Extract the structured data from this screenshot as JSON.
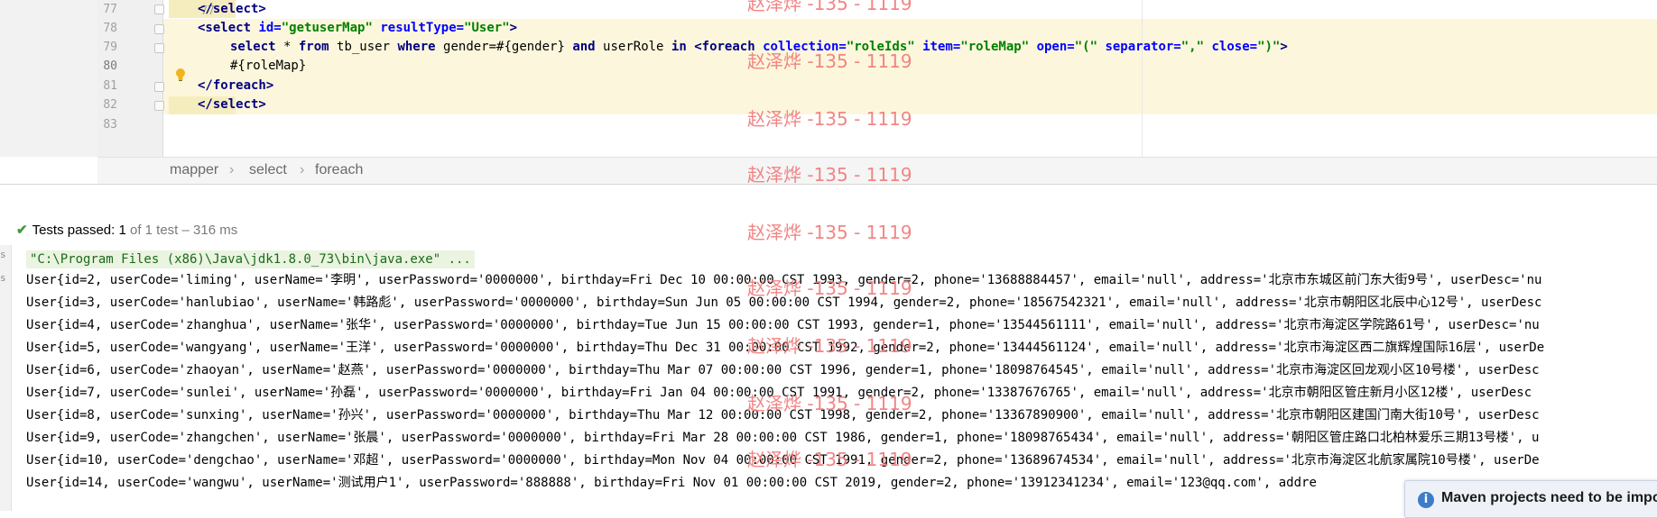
{
  "editor": {
    "line_numbers": [
      "77",
      "78",
      "79",
      "80",
      "81",
      "82",
      "83"
    ],
    "code": {
      "l77_close_select": "</select>",
      "l78_select_open": "<select",
      "l78_attr_id": "id=",
      "l78_val_id": "\"getuserMap\"",
      "l78_attr_type": "resultType=",
      "l78_val_type": "\"User\"",
      "l78_end": ">",
      "l79_sql_select": "select",
      "l79_sql_star": " * ",
      "l79_sql_from": "from",
      "l79_sql_table": " tb_user ",
      "l79_sql_where": "where",
      "l79_sql_gender": " gender=#{gender} ",
      "l79_sql_and": "and",
      "l79_sql_userrole": " userRole ",
      "l79_sql_in": "in",
      "l79_space": " ",
      "l79_foreach_open": "<foreach",
      "l79_attr_collection": "collection=",
      "l79_val_collection": "\"roleIds\"",
      "l79_attr_item": "item=",
      "l79_val_item": "\"roleMap\"",
      "l79_attr_open": "open=",
      "l79_val_open": "\"(\"",
      "l79_attr_separator": "separator=",
      "l79_val_separator": "\",\"",
      "l79_attr_close": "close=",
      "l79_val_close": "\")\"",
      "l79_end": ">",
      "l80_rolemap": "#{roleMap}",
      "l81_close_foreach": "</foreach>",
      "l82_close_select": "</select>"
    }
  },
  "breadcrumbs": [
    "mapper",
    "select",
    "foreach"
  ],
  "breadcrumb_separator": "›",
  "tests": {
    "passed_label": "Tests passed:",
    "passed_count": "1",
    "detail": "of 1 test – 316 ms"
  },
  "console": {
    "command": "\"C:\\Program Files (x86)\\Java\\jdk1.8.0_73\\bin\\java.exe\" ...",
    "lines": [
      "User{id=2, userCode='liming', userName='李明', userPassword='0000000', birthday=Fri Dec 10 00:00:00 CST 1993, gender=2, phone='13688884457', email='null', address='北京市东城区前门东大街9号', userDesc='nu",
      "User{id=3, userCode='hanlubiao', userName='韩路彪', userPassword='0000000', birthday=Sun Jun 05 00:00:00 CST 1994, gender=2, phone='18567542321', email='null', address='北京市朝阳区北辰中心12号', userDesc",
      "User{id=4, userCode='zhanghua', userName='张华', userPassword='0000000', birthday=Tue Jun 15 00:00:00 CST 1993, gender=1, phone='13544561111', email='null', address='北京市海淀区学院路61号', userDesc='nu",
      "User{id=5, userCode='wangyang', userName='王洋', userPassword='0000000', birthday=Thu Dec 31 00:00:00 CST 1992, gender=2, phone='13444561124', email='null', address='北京市海淀区西二旗辉煌国际16层', userDe",
      "User{id=6, userCode='zhaoyan', userName='赵燕', userPassword='0000000', birthday=Thu Mar 07 00:00:00 CST 1996, gender=1, phone='18098764545', email='null', address='北京市海淀区回龙观小区10号楼', userDesc",
      "User{id=7, userCode='sunlei', userName='孙磊', userPassword='0000000', birthday=Fri Jan 04 00:00:00 CST 1991, gender=2, phone='13387676765', email='null', address='北京市朝阳区管庄新月小区12楼', userDesc",
      "User{id=8, userCode='sunxing', userName='孙兴', userPassword='0000000', birthday=Thu Mar 12 00:00:00 CST 1998, gender=2, phone='13367890900', email='null', address='北京市朝阳区建国门南大街10号', userDesc",
      "User{id=9, userCode='zhangchen', userName='张晨', userPassword='0000000', birthday=Fri Mar 28 00:00:00 CST 1986, gender=1, phone='18098765434', email='null', address='朝阳区管庄路口北柏林爱乐三期13号楼', u",
      "User{id=10, userCode='dengchao', userName='邓超', userPassword='0000000', birthday=Mon Nov 04 00:00:00 CST 1991, gender=2, phone='13689674534', email='null', address='北京市海淀区北航家属院10号楼', userDe",
      "User{id=14, userCode='wangwu', userName='测试用户1', userPassword='888888', birthday=Fri Nov 01 00:00:00 CST 2019, gender=2, phone='13912341234', email='123@qq.com', addre"
    ]
  },
  "watermark_text": "赵泽烨 -135 - 1119",
  "notification": {
    "text": "Maven projects need to be impo",
    "icon": "info-icon"
  },
  "colors": {
    "highlight": "#fcf7dc",
    "xml_tag": "#000080",
    "xml_attr": "#0000ff",
    "xml_value": "#008000",
    "watermark": "#f17b7b",
    "test_pass": "#3f9b3f"
  }
}
